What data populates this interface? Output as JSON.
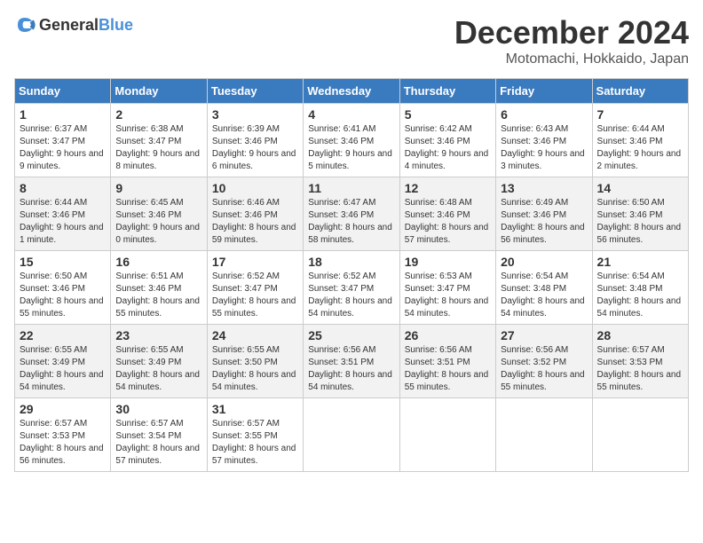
{
  "header": {
    "logo_general": "General",
    "logo_blue": "Blue",
    "month_title": "December 2024",
    "location": "Motomachi, Hokkaido, Japan"
  },
  "weekdays": [
    "Sunday",
    "Monday",
    "Tuesday",
    "Wednesday",
    "Thursday",
    "Friday",
    "Saturday"
  ],
  "weeks": [
    [
      {
        "day": "1",
        "sunrise": "6:37 AM",
        "sunset": "3:47 PM",
        "daylight": "9 hours and 9 minutes."
      },
      {
        "day": "2",
        "sunrise": "6:38 AM",
        "sunset": "3:47 PM",
        "daylight": "9 hours and 8 minutes."
      },
      {
        "day": "3",
        "sunrise": "6:39 AM",
        "sunset": "3:46 PM",
        "daylight": "9 hours and 6 minutes."
      },
      {
        "day": "4",
        "sunrise": "6:41 AM",
        "sunset": "3:46 PM",
        "daylight": "9 hours and 5 minutes."
      },
      {
        "day": "5",
        "sunrise": "6:42 AM",
        "sunset": "3:46 PM",
        "daylight": "9 hours and 4 minutes."
      },
      {
        "day": "6",
        "sunrise": "6:43 AM",
        "sunset": "3:46 PM",
        "daylight": "9 hours and 3 minutes."
      },
      {
        "day": "7",
        "sunrise": "6:44 AM",
        "sunset": "3:46 PM",
        "daylight": "9 hours and 2 minutes."
      }
    ],
    [
      {
        "day": "8",
        "sunrise": "6:44 AM",
        "sunset": "3:46 PM",
        "daylight": "9 hours and 1 minute."
      },
      {
        "day": "9",
        "sunrise": "6:45 AM",
        "sunset": "3:46 PM",
        "daylight": "9 hours and 0 minutes."
      },
      {
        "day": "10",
        "sunrise": "6:46 AM",
        "sunset": "3:46 PM",
        "daylight": "8 hours and 59 minutes."
      },
      {
        "day": "11",
        "sunrise": "6:47 AM",
        "sunset": "3:46 PM",
        "daylight": "8 hours and 58 minutes."
      },
      {
        "day": "12",
        "sunrise": "6:48 AM",
        "sunset": "3:46 PM",
        "daylight": "8 hours and 57 minutes."
      },
      {
        "day": "13",
        "sunrise": "6:49 AM",
        "sunset": "3:46 PM",
        "daylight": "8 hours and 56 minutes."
      },
      {
        "day": "14",
        "sunrise": "6:50 AM",
        "sunset": "3:46 PM",
        "daylight": "8 hours and 56 minutes."
      }
    ],
    [
      {
        "day": "15",
        "sunrise": "6:50 AM",
        "sunset": "3:46 PM",
        "daylight": "8 hours and 55 minutes."
      },
      {
        "day": "16",
        "sunrise": "6:51 AM",
        "sunset": "3:46 PM",
        "daylight": "8 hours and 55 minutes."
      },
      {
        "day": "17",
        "sunrise": "6:52 AM",
        "sunset": "3:47 PM",
        "daylight": "8 hours and 55 minutes."
      },
      {
        "day": "18",
        "sunrise": "6:52 AM",
        "sunset": "3:47 PM",
        "daylight": "8 hours and 54 minutes."
      },
      {
        "day": "19",
        "sunrise": "6:53 AM",
        "sunset": "3:47 PM",
        "daylight": "8 hours and 54 minutes."
      },
      {
        "day": "20",
        "sunrise": "6:54 AM",
        "sunset": "3:48 PM",
        "daylight": "8 hours and 54 minutes."
      },
      {
        "day": "21",
        "sunrise": "6:54 AM",
        "sunset": "3:48 PM",
        "daylight": "8 hours and 54 minutes."
      }
    ],
    [
      {
        "day": "22",
        "sunrise": "6:55 AM",
        "sunset": "3:49 PM",
        "daylight": "8 hours and 54 minutes."
      },
      {
        "day": "23",
        "sunrise": "6:55 AM",
        "sunset": "3:49 PM",
        "daylight": "8 hours and 54 minutes."
      },
      {
        "day": "24",
        "sunrise": "6:55 AM",
        "sunset": "3:50 PM",
        "daylight": "8 hours and 54 minutes."
      },
      {
        "day": "25",
        "sunrise": "6:56 AM",
        "sunset": "3:51 PM",
        "daylight": "8 hours and 54 minutes."
      },
      {
        "day": "26",
        "sunrise": "6:56 AM",
        "sunset": "3:51 PM",
        "daylight": "8 hours and 55 minutes."
      },
      {
        "day": "27",
        "sunrise": "6:56 AM",
        "sunset": "3:52 PM",
        "daylight": "8 hours and 55 minutes."
      },
      {
        "day": "28",
        "sunrise": "6:57 AM",
        "sunset": "3:53 PM",
        "daylight": "8 hours and 55 minutes."
      }
    ],
    [
      {
        "day": "29",
        "sunrise": "6:57 AM",
        "sunset": "3:53 PM",
        "daylight": "8 hours and 56 minutes."
      },
      {
        "day": "30",
        "sunrise": "6:57 AM",
        "sunset": "3:54 PM",
        "daylight": "8 hours and 57 minutes."
      },
      {
        "day": "31",
        "sunrise": "6:57 AM",
        "sunset": "3:55 PM",
        "daylight": "8 hours and 57 minutes."
      },
      null,
      null,
      null,
      null
    ]
  ]
}
